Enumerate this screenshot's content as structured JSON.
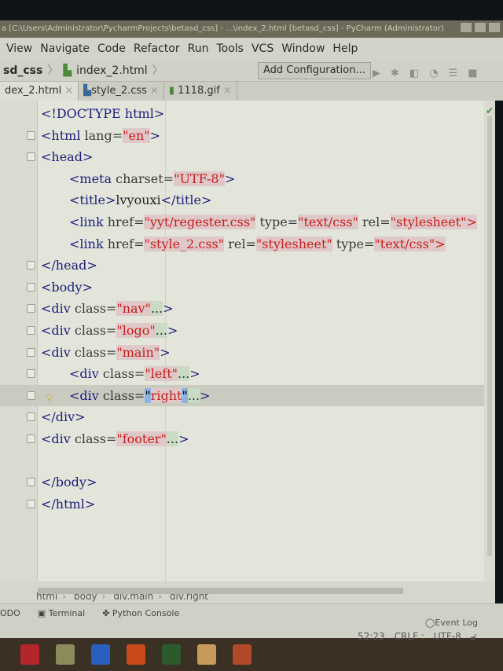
{
  "window": {
    "title": "a [C:\\Users\\Administrator\\PycharmProjects\\betasd_css] - ...\\index_2.html [betasd_css] - PyCharm (Administrator)"
  },
  "menu": [
    "View",
    "Navigate",
    "Code",
    "Refactor",
    "Run",
    "Tools",
    "VCS",
    "Window",
    "Help"
  ],
  "navbar": {
    "project": "sd_css",
    "file": "index_2.html",
    "add_configuration": "Add Configuration..."
  },
  "tabs": [
    {
      "label": "dex_2.html",
      "active": true
    },
    {
      "label": "style_2.css",
      "active": false
    },
    {
      "label": "1118.gif",
      "active": false
    }
  ],
  "code": [
    {
      "indent": 0,
      "fold": false,
      "tokens": [
        [
          "tag",
          "<!DOCTYPE html>"
        ]
      ]
    },
    {
      "indent": 0,
      "fold": true,
      "tokens": [
        [
          "tag",
          "<html "
        ],
        [
          "attr",
          "lang="
        ],
        [
          "str",
          "\"en\""
        ],
        [
          "tag",
          ">"
        ]
      ]
    },
    {
      "indent": 0,
      "fold": true,
      "tokens": [
        [
          "tag",
          "<head>"
        ]
      ]
    },
    {
      "indent": 1,
      "fold": false,
      "tokens": [
        [
          "tag",
          "<meta "
        ],
        [
          "attr",
          "charset="
        ],
        [
          "str",
          "\"UTF-8\""
        ],
        [
          "tag",
          ">"
        ]
      ]
    },
    {
      "indent": 1,
      "fold": false,
      "tokens": [
        [
          "tag",
          "<title>"
        ],
        [
          "text",
          "lvyouxi"
        ],
        [
          "tag",
          "</title>"
        ]
      ]
    },
    {
      "indent": 1,
      "fold": false,
      "tokens": [
        [
          "tag",
          "<link "
        ],
        [
          "attr",
          "href="
        ],
        [
          "str",
          "\"yyt/regester.css\""
        ],
        [
          "attr",
          " type="
        ],
        [
          "str",
          "\"text/css\""
        ],
        [
          "attr",
          " rel="
        ],
        [
          "str",
          "\"stylesheet\">"
        ]
      ]
    },
    {
      "indent": 1,
      "fold": false,
      "tokens": [
        [
          "tag",
          "<link "
        ],
        [
          "attr",
          "href="
        ],
        [
          "str",
          "\"style_2.css\""
        ],
        [
          "attr",
          " rel="
        ],
        [
          "str",
          "\"stylesheet\""
        ],
        [
          "attr",
          " type="
        ],
        [
          "str",
          "\"text/css\">"
        ]
      ]
    },
    {
      "indent": 0,
      "fold": true,
      "tokens": [
        [
          "tag",
          "</head>"
        ]
      ]
    },
    {
      "indent": 0,
      "fold": true,
      "tokens": [
        [
          "tag",
          "<body>"
        ]
      ]
    },
    {
      "indent": 0,
      "fold": true,
      "tokens": [
        [
          "tag",
          "<div "
        ],
        [
          "attr",
          "class="
        ],
        [
          "str",
          "\"nav\""
        ],
        [
          "fold",
          "..."
        ],
        [
          "tag",
          ">"
        ]
      ]
    },
    {
      "indent": 0,
      "fold": true,
      "tokens": [
        [
          "tag",
          "<div "
        ],
        [
          "attr",
          "class="
        ],
        [
          "str",
          "\"logo\""
        ],
        [
          "fold",
          "..."
        ],
        [
          "tag",
          ">"
        ]
      ]
    },
    {
      "indent": 0,
      "fold": true,
      "tokens": [
        [
          "tag",
          "<div "
        ],
        [
          "attr",
          "class="
        ],
        [
          "str",
          "\"main\""
        ],
        [
          "tag",
          ">"
        ]
      ]
    },
    {
      "indent": 1,
      "fold": true,
      "tokens": [
        [
          "tag",
          "<div "
        ],
        [
          "attr",
          "class="
        ],
        [
          "str",
          "\"left\""
        ],
        [
          "fold",
          "..."
        ],
        [
          "tag",
          ">"
        ]
      ]
    },
    {
      "indent": 1,
      "fold": true,
      "highlight": true,
      "bulb": true,
      "tokens": [
        [
          "tag",
          "<div "
        ],
        [
          "attr",
          "class="
        ],
        [
          "sel",
          "\""
        ],
        [
          "str",
          "right"
        ],
        [
          "sel",
          "\""
        ],
        [
          "fold",
          "..."
        ],
        [
          "tag",
          ">"
        ]
      ]
    },
    {
      "indent": 0,
      "fold": true,
      "tokens": [
        [
          "tag",
          "</div>"
        ]
      ]
    },
    {
      "indent": 0,
      "fold": true,
      "tokens": [
        [
          "tag",
          "<div "
        ],
        [
          "attr",
          "class="
        ],
        [
          "str",
          "\"footer\""
        ],
        [
          "fold",
          "..."
        ],
        [
          "tag",
          ">"
        ]
      ]
    },
    {
      "indent": 0,
      "fold": false,
      "tokens": []
    },
    {
      "indent": 0,
      "fold": true,
      "tokens": [
        [
          "tag",
          "</body>"
        ]
      ]
    },
    {
      "indent": 0,
      "fold": true,
      "tokens": [
        [
          "tag",
          "</html>"
        ]
      ]
    }
  ],
  "breadcrumbs": [
    "html",
    "body",
    "div.main",
    "div.right"
  ],
  "toolwindows": {
    "todo": "ODO",
    "terminal": "Terminal",
    "python_console": "Python Console"
  },
  "status": {
    "event_log": "Event Log",
    "position": "52:23",
    "line_sep": "CRLF :",
    "encoding": "UTF-8"
  },
  "taskbar": [
    {
      "name": "app-red",
      "color": "#b3262a"
    },
    {
      "name": "file-explorer",
      "color": "#8a8a5a"
    },
    {
      "name": "ifeng-app",
      "color": "#2a5fbf"
    },
    {
      "name": "firefox",
      "color": "#c84a1a"
    },
    {
      "name": "pycharm",
      "color": "#2d5a2d"
    },
    {
      "name": "app-paint",
      "color": "#c89a5a"
    },
    {
      "name": "chrome",
      "color": "#b04a2a"
    }
  ]
}
